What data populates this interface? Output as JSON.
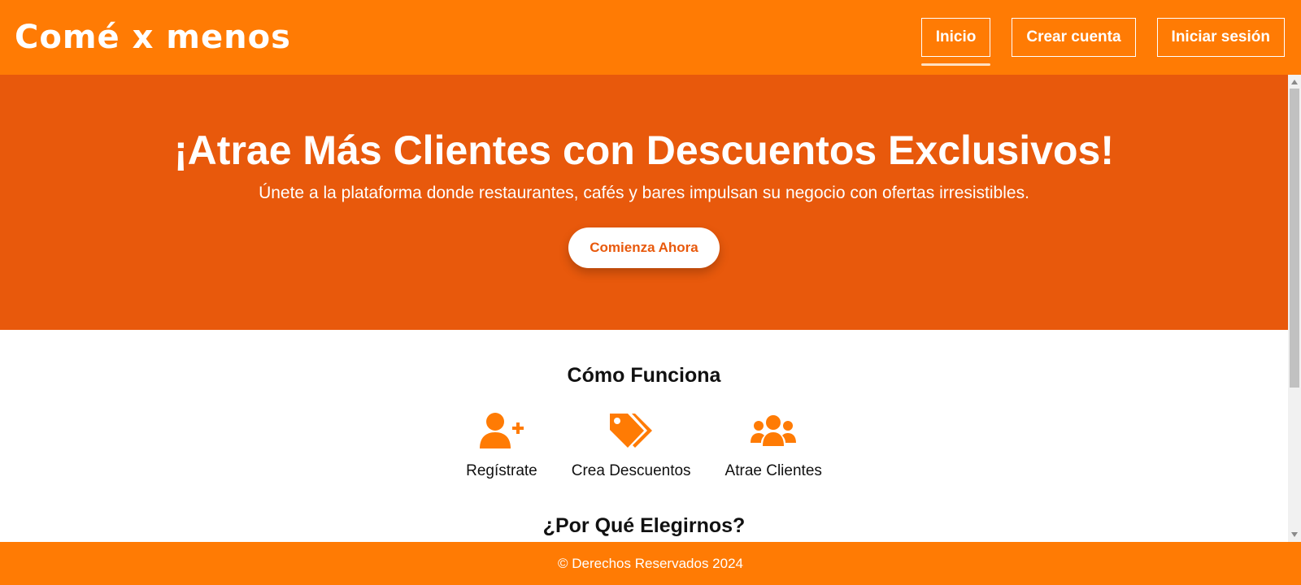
{
  "navbar": {
    "brand": "Comé x menos",
    "links": [
      {
        "label": "Inicio",
        "active": true
      },
      {
        "label": "Crear cuenta"
      },
      {
        "label": "Iniciar sesión"
      }
    ]
  },
  "hero": {
    "title": "¡Atrae Más Clientes con Descuentos Exclusivos!",
    "subtitle": "Únete a la plataforma donde restaurantes, cafés y bares impulsan su negocio con ofertas irresistibles.",
    "cta_label": "Comienza Ahora"
  },
  "how_it_works": {
    "title": "Cómo Funciona",
    "steps": [
      {
        "icon": "user-plus-icon",
        "label": "Regístrate"
      },
      {
        "icon": "tags-icon",
        "label": "Crea Descuentos"
      },
      {
        "icon": "users-icon",
        "label": "Atrae Clientes"
      }
    ]
  },
  "why_us": {
    "title": "¿Por Qué Elegirnos?"
  },
  "footer": {
    "text": "© Derechos Reservados 2024"
  },
  "colors": {
    "nav_orange": "#ff7b04",
    "hero_orange": "#e8590c",
    "icon_orange": "#ff7b04",
    "white": "#ffffff"
  }
}
